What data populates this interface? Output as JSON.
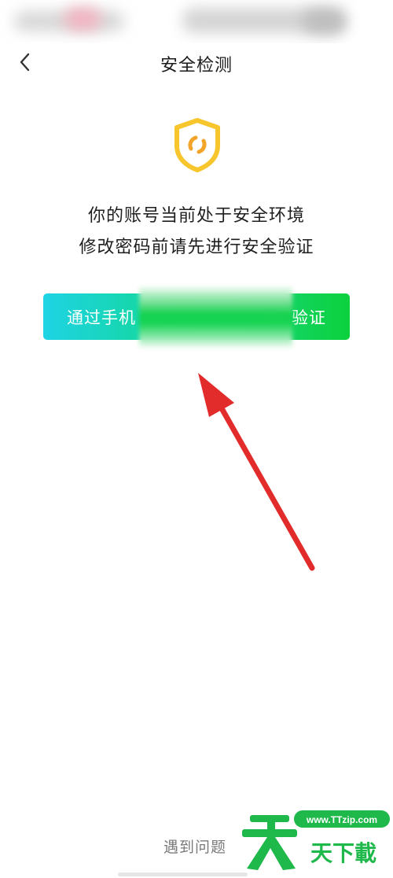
{
  "nav": {
    "title": "安全检测"
  },
  "message": {
    "line1": "你的账号当前处于安全环境",
    "line2": "修改密码前请先进行安全验证"
  },
  "verify_button": {
    "label_start": "通过手机",
    "label_end": "验证"
  },
  "footer": {
    "help_text": "遇到问题"
  },
  "watermark": {
    "url": "www.TTzip.com",
    "text": "天下載"
  },
  "icons": {
    "back": "chevron-left-icon",
    "shield": "shield-icon"
  },
  "colors": {
    "shield": "#f7c52c",
    "button_gradient_start": "#1fd3e4",
    "button_gradient_end": "#0cd13c",
    "arrow": "#e22b2b",
    "watermark_green": "#1fb84a"
  }
}
